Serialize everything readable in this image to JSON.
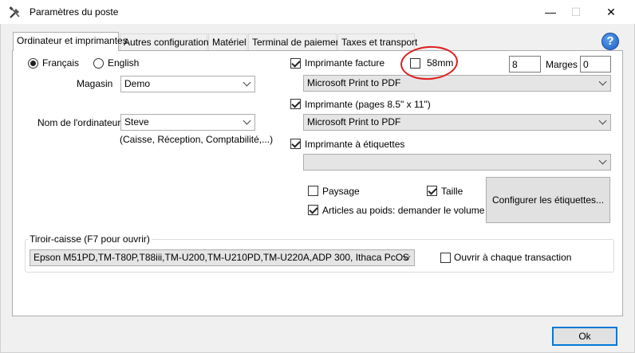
{
  "window": {
    "title": "Paramètres du poste",
    "icon": "tools-icon",
    "minimize_icon": "minimize-icon",
    "maximize_icon": "maximize-icon",
    "close_icon": "close-icon",
    "minimize_glyph": "—",
    "maximize_glyph": "☐",
    "close_glyph": "✕"
  },
  "tabs": [
    {
      "label": "Ordinateur et imprimantes",
      "active": true
    },
    {
      "label": "Autres configurations"
    },
    {
      "label": "Matériel"
    },
    {
      "label": "Terminal de paiement"
    },
    {
      "label": "Taxes et transport"
    }
  ],
  "help": {
    "glyph": "?"
  },
  "language": {
    "options": [
      {
        "label": "Français",
        "selected": true
      },
      {
        "label": "English",
        "selected": false
      }
    ]
  },
  "store": {
    "label": "Magasin",
    "value": "Demo"
  },
  "computer": {
    "label": "Nom de l'ordinateur",
    "value": "Steve",
    "hint": "(Caisse, Réception, Comptabilité,...)"
  },
  "invoice_printer": {
    "label": "Imprimante facture",
    "checked": true,
    "value": "Microsoft Print to PDF",
    "paper_58mm": {
      "label": "58mm",
      "checked": false
    },
    "width_value": "8",
    "margins_label": "Marges",
    "margins_value": "0"
  },
  "page_printer": {
    "label": "Imprimante (pages 8.5\" x 11\")",
    "checked": true,
    "value": "Microsoft Print to PDF"
  },
  "label_printer": {
    "label": "Imprimante à étiquettes",
    "checked": true,
    "value": ""
  },
  "label_options": {
    "landscape": {
      "label": "Paysage",
      "checked": false
    },
    "size": {
      "label": "Taille",
      "checked": true
    },
    "weight_items": {
      "label": "Articles au poids: demander le volume",
      "checked": true
    },
    "configure_button": "Configurer les étiquettes..."
  },
  "cash_drawer": {
    "group_title": "Tiroir-caisse (F7 pour ouvrir)",
    "value": "Epson M51PD,TM-T80P,T88iii,TM-U200,TM-U210PD,TM-U220A,ADP 300, Ithaca PcOS",
    "open_each": {
      "label": "Ouvrir à chaque transaction",
      "checked": false
    }
  },
  "ok_button": "Ok",
  "accent": {
    "annotation": "#e01e1e",
    "help": "#1b5fc1",
    "focus": "#0078d7"
  }
}
